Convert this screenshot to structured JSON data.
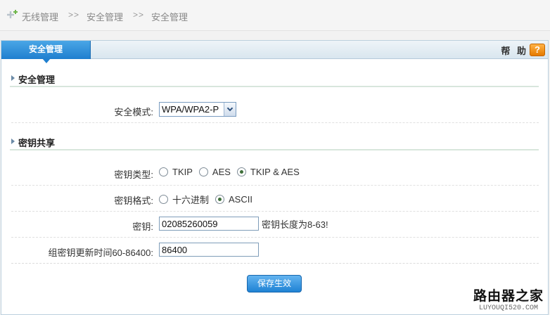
{
  "breadcrumb": {
    "items": [
      "无线管理",
      "安全管理",
      "安全管理"
    ],
    "separator": ">>"
  },
  "tab": {
    "label": "安全管理"
  },
  "help": {
    "label": "帮 助",
    "icon": "?"
  },
  "sections": {
    "security": {
      "title": "安全管理"
    },
    "key_share": {
      "title": "密钥共享"
    }
  },
  "form": {
    "security_mode": {
      "label": "安全模式:",
      "value": "WPA/WPA2-P"
    },
    "key_type": {
      "label": "密钥类型:",
      "options": [
        "TKIP",
        "AES",
        "TKIP & AES"
      ],
      "selected": "TKIP & AES"
    },
    "key_format": {
      "label": "密钥格式:",
      "options": [
        "十六进制",
        "ASCII"
      ],
      "selected": "ASCII"
    },
    "key": {
      "label": "密钥:",
      "value": "02085260059",
      "hint": "密钥长度为8-63!"
    },
    "group_key_renewal": {
      "label": "组密钥更新时间60-86400:",
      "value": "86400"
    }
  },
  "save_button": {
    "label": "保存生效"
  },
  "watermark": {
    "main": "路由器之家",
    "sub": "LUYOUQI520.COM"
  },
  "colors": {
    "accent": "#1f7fcf",
    "help_orange": "#e57a00"
  }
}
